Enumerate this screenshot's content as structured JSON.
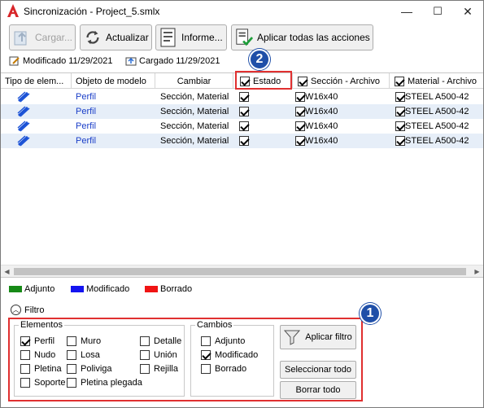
{
  "window": {
    "title": "Sincronización - Project_5.smlx",
    "minimize_glyph": "—",
    "maximize_glyph": "☐",
    "close_glyph": "✕"
  },
  "toolbar": {
    "load_label": "Cargar...",
    "update_label": "Actualizar",
    "report_label": "Informe...",
    "apply_all_label": "Aplicar todas las acciones"
  },
  "status": {
    "modified": "Modificado 11/29/2021",
    "loaded": "Cargado 11/29/2021"
  },
  "grid": {
    "columns": {
      "element_type": "Tipo de elem...",
      "model_object": "Objeto de modelo",
      "change": "Cambiar",
      "state": "Estado",
      "section": "Sección - Archivo",
      "material": "Material - Archivo"
    },
    "rows": [
      {
        "object": "Perfil",
        "change": "Sección, Material",
        "section": "W16x40",
        "material": "STEEL A500-42"
      },
      {
        "object": "Perfil",
        "change": "Sección, Material",
        "section": "W16x40",
        "material": "STEEL A500-42"
      },
      {
        "object": "Perfil",
        "change": "Sección, Material",
        "section": "W16x40",
        "material": "STEEL A500-42"
      },
      {
        "object": "Perfil",
        "change": "Sección, Material",
        "section": "W16x40",
        "material": "STEEL A500-42"
      }
    ]
  },
  "callouts": {
    "one": "1",
    "two": "2"
  },
  "legend": {
    "added": "Adjunto",
    "modified": "Modificado",
    "deleted": "Borrado",
    "colors": {
      "added": "#178a17",
      "modified": "#1414f0",
      "deleted": "#f01414"
    }
  },
  "filter": {
    "toggle_label": "Filtro",
    "elements_title": "Elementos",
    "elements": {
      "perfil": "Perfil",
      "nudo": "Nudo",
      "pletina": "Pletina",
      "soporte": "Soporte",
      "muro": "Muro",
      "losa": "Losa",
      "poliviga": "Poliviga",
      "pletina_plegada": "Pletina plegada",
      "detalle": "Detalle",
      "union": "Unión",
      "rejilla": "Rejilla"
    },
    "changes_title": "Cambios",
    "changes": {
      "adjunto": "Adjunto",
      "modificado": "Modificado",
      "borrado": "Borrado"
    },
    "apply_label": "Aplicar filtro",
    "select_all_label": "Seleccionar todo",
    "clear_all_label": "Borrar todo"
  }
}
